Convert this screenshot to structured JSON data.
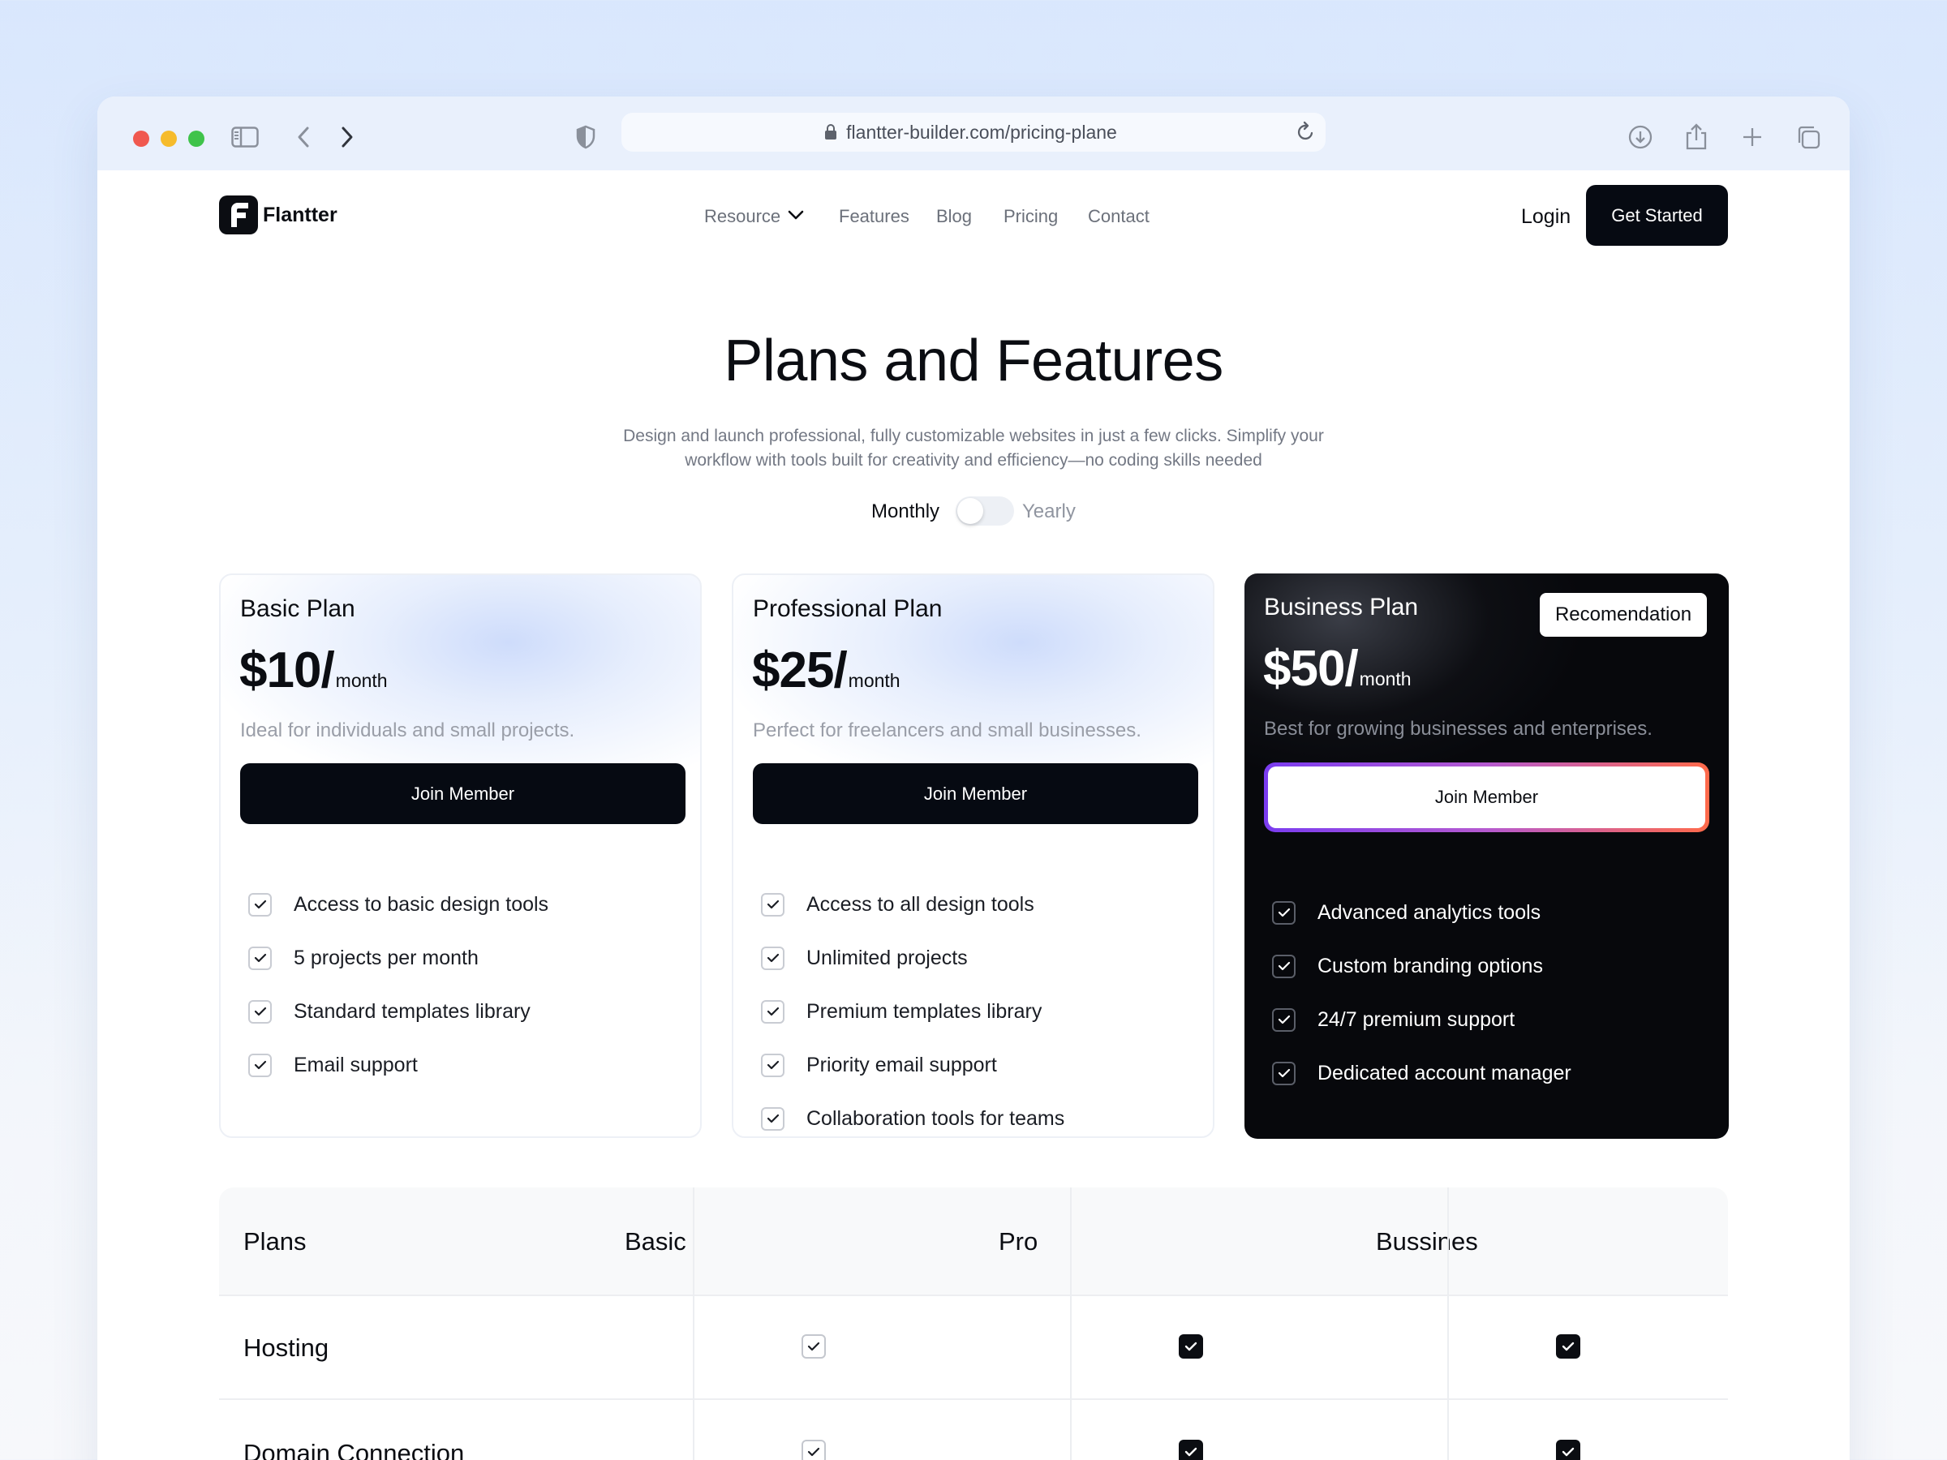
{
  "browser": {
    "url": "flantter-builder.com/pricing-plane"
  },
  "nav": {
    "brand": "Flantter",
    "links": [
      "Resource",
      "Features",
      "Blog",
      "Pricing",
      "Contact"
    ],
    "login": "Login",
    "cta": "Get Started"
  },
  "hero": {
    "title": "Plans and Features",
    "subtitle_line1": "Design and launch professional, fully customizable websites in just a few clicks. Simplify your",
    "subtitle_line2": "workflow with tools built for creativity and efficiency—no coding skills needed",
    "toggle": {
      "left": "Monthly",
      "right": "Yearly",
      "selected": "Monthly"
    }
  },
  "plans": [
    {
      "name": "Basic Plan",
      "price": "$10/",
      "period": "month",
      "description": "Ideal for individuals and small projects.",
      "button": "Join Member",
      "features": [
        "Access to basic design tools",
        "5 projects per month",
        "Standard templates library",
        "Email support"
      ]
    },
    {
      "name": "Professional Plan",
      "price": "$25/",
      "period": "month",
      "description": "Perfect for freelancers and small businesses.",
      "button": "Join Member",
      "features": [
        "Access to all design tools",
        "Unlimited projects",
        "Premium templates library",
        "Priority email support",
        "Collaboration tools for teams"
      ]
    },
    {
      "name": "Business Plan",
      "badge": "Recomendation",
      "price": "$50/",
      "period": "month",
      "description": "Best for growing businesses and enterprises.",
      "button": "Join Member",
      "features": [
        "Advanced analytics tools",
        "Custom branding options",
        "24/7 premium support",
        "Dedicated account manager"
      ]
    }
  ],
  "comparison": {
    "headers": [
      "Plans",
      "Basic",
      "Pro",
      "Bussines"
    ],
    "rows": [
      {
        "label": "Hosting",
        "basic": "outline-check",
        "pro": "filled-check",
        "business": "filled-check"
      },
      {
        "label": "Domain Connection",
        "basic": "outline-check",
        "pro": "filled-check",
        "business": "filled-check"
      }
    ]
  }
}
